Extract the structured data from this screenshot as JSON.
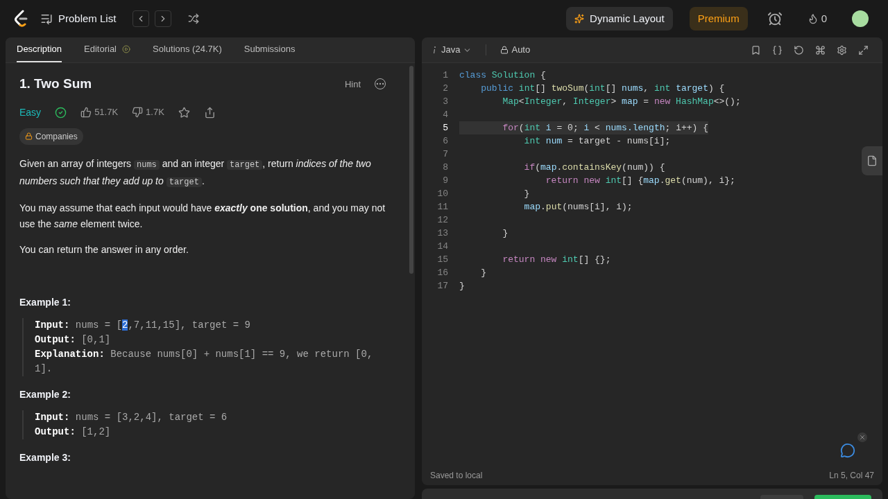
{
  "topbar": {
    "nav_label": "Problem List",
    "dynamic_layout": "Dynamic Layout",
    "premium": "Premium",
    "streak": "0"
  },
  "tabs": [
    {
      "label": "Description",
      "selected": true,
      "kind": "plain"
    },
    {
      "label": "Editorial",
      "selected": false,
      "kind": "video"
    },
    {
      "label": "Solutions (24.7K)",
      "selected": false,
      "kind": "plain"
    },
    {
      "label": "Submissions",
      "selected": false,
      "kind": "plain"
    }
  ],
  "problem": {
    "title": "1. Two Sum",
    "hint": "Hint",
    "difficulty": "Easy",
    "solved": true,
    "likes": "51.7K",
    "dislikes": "1.7K",
    "companies": "Companies",
    "paragraphs": [
      [
        {
          "kind": "text",
          "text": "Given an array of integers "
        },
        {
          "kind": "code",
          "text": "nums"
        },
        {
          "kind": "text",
          "text": " and an integer "
        },
        {
          "kind": "code",
          "text": "target"
        },
        {
          "kind": "text",
          "text": ", return *indices of the two numbers such that they add up to* "
        },
        {
          "kind": "code",
          "text": "target"
        },
        {
          "kind": "text",
          "text": "."
        }
      ],
      [
        {
          "kind": "text",
          "text": "You may assume that each input would have "
        },
        {
          "kind": "emphasis",
          "text": "exactly"
        },
        {
          "kind": "text",
          "text": " **one solution**, and you may not use the *same* element twice."
        }
      ],
      [
        {
          "kind": "text",
          "text": "You can return the answer in any order."
        }
      ]
    ],
    "examples": [
      {
        "title": "Example 1:",
        "lines": [
          {
            "label": "Input:",
            "value": [
              {
                "text": "nums = [",
                "selected": false
              },
              {
                "text": "2",
                "selected": true
              },
              {
                "text": ",7,11,15], target = 9",
                "selected": false
              }
            ]
          },
          {
            "label": "Output:",
            "value": [
              {
                "text": "[0,1]",
                "selected": false
              }
            ]
          },
          {
            "label": "Explanation:",
            "value": [
              {
                "text": "Because nums[0] + nums[1] == 9, we return [0, 1].",
                "selected": false
              }
            ]
          }
        ]
      },
      {
        "title": "Example 2:",
        "lines": [
          {
            "label": "Input:",
            "value": [
              {
                "text": "nums = [3,2,4], target = 6",
                "selected": false
              }
            ]
          },
          {
            "label": "Output:",
            "value": [
              {
                "text": "[1,2]",
                "selected": false
              }
            ]
          }
        ]
      },
      {
        "title": "Example 3:"
      }
    ]
  },
  "editor": {
    "language": "Java",
    "mode": "Auto",
    "lines": [
      {
        "number": "1",
        "current": false,
        "tokens": [
          {
            "kind": "kw",
            "text": "class "
          },
          {
            "kind": "type",
            "text": "Solution"
          },
          {
            "kind": "plain",
            "text": " {"
          }
        ]
      },
      {
        "number": "2",
        "current": false,
        "tokens": [
          {
            "kind": "kw",
            "text": "    public "
          },
          {
            "kind": "type",
            "text": "int"
          },
          {
            "kind": "plain",
            "text": "[] "
          },
          {
            "kind": "fn",
            "text": "twoSum"
          },
          {
            "kind": "plain",
            "text": "("
          },
          {
            "kind": "type",
            "text": "int"
          },
          {
            "kind": "plain",
            "text": "[] "
          },
          {
            "kind": "var",
            "text": "nums"
          },
          {
            "kind": "plain",
            "text": ", "
          },
          {
            "kind": "type",
            "text": "int "
          },
          {
            "kind": "var",
            "text": "target"
          },
          {
            "kind": "plain",
            "text": ") {"
          }
        ]
      },
      {
        "number": "3",
        "current": false,
        "tokens": [
          {
            "kind": "type",
            "text": "        Map"
          },
          {
            "kind": "plain",
            "text": "<"
          },
          {
            "kind": "type",
            "text": "Integer"
          },
          {
            "kind": "plain",
            "text": ", "
          },
          {
            "kind": "type",
            "text": "Integer"
          },
          {
            "kind": "plain",
            "text": "> "
          },
          {
            "kind": "var",
            "text": "map"
          },
          {
            "kind": "plain",
            "text": " = "
          },
          {
            "kind": "ctrl",
            "text": "new "
          },
          {
            "kind": "type",
            "text": "HashMap"
          },
          {
            "kind": "plain",
            "text": "<>();"
          }
        ]
      },
      {
        "number": "4",
        "current": false
      },
      {
        "number": "5",
        "current": true,
        "tokens": [
          {
            "kind": "ctrl",
            "text": "        for"
          },
          {
            "kind": "plain",
            "text": "("
          },
          {
            "kind": "type",
            "text": "int "
          },
          {
            "kind": "var",
            "text": "i"
          },
          {
            "kind": "plain",
            "text": " = 0; "
          },
          {
            "kind": "var",
            "text": "i"
          },
          {
            "kind": "plain",
            "text": " < "
          },
          {
            "kind": "var",
            "text": "nums.length"
          },
          {
            "kind": "plain",
            "text": "; i++) {"
          }
        ]
      },
      {
        "number": "6",
        "current": false,
        "tokens": [
          {
            "kind": "type",
            "text": "            int "
          },
          {
            "kind": "var",
            "text": "num"
          },
          {
            "kind": "plain",
            "text": " = target - nums[i];"
          }
        ]
      },
      {
        "number": "7",
        "current": false
      },
      {
        "number": "8",
        "current": false,
        "tokens": [
          {
            "kind": "ctrl",
            "text": "            if"
          },
          {
            "kind": "plain",
            "text": "("
          },
          {
            "kind": "var",
            "text": "map"
          },
          {
            "kind": "plain",
            "text": "."
          },
          {
            "kind": "fn",
            "text": "containsKey"
          },
          {
            "kind": "plain",
            "text": "(num)) {"
          }
        ]
      },
      {
        "number": "9",
        "current": false,
        "tokens": [
          {
            "kind": "ctrl",
            "text": "                return new "
          },
          {
            "kind": "type",
            "text": "int"
          },
          {
            "kind": "plain",
            "text": "[] {"
          },
          {
            "kind": "var",
            "text": "map"
          },
          {
            "kind": "plain",
            "text": "."
          },
          {
            "kind": "fn",
            "text": "get"
          },
          {
            "kind": "plain",
            "text": "(num), i};"
          }
        ]
      },
      {
        "number": "10",
        "current": false,
        "tokens": [
          {
            "kind": "plain",
            "text": "            }"
          }
        ]
      },
      {
        "number": "11",
        "current": false,
        "tokens": [
          {
            "kind": "var",
            "text": "            map"
          },
          {
            "kind": "plain",
            "text": "."
          },
          {
            "kind": "fn",
            "text": "put"
          },
          {
            "kind": "plain",
            "text": "(nums[i], i);"
          }
        ]
      },
      {
        "number": "12",
        "current": false
      },
      {
        "number": "13",
        "current": false,
        "tokens": [
          {
            "kind": "plain",
            "text": "        }"
          }
        ]
      },
      {
        "number": "14",
        "current": false
      },
      {
        "number": "15",
        "current": false,
        "tokens": [
          {
            "kind": "ctrl",
            "text": "        return new "
          },
          {
            "kind": "type",
            "text": "int"
          },
          {
            "kind": "plain",
            "text": "[] {};"
          }
        ]
      },
      {
        "number": "16",
        "current": false,
        "tokens": [
          {
            "kind": "plain",
            "text": "    }"
          }
        ]
      },
      {
        "number": "17",
        "current": false,
        "tokens": [
          {
            "kind": "plain",
            "text": "}"
          }
        ]
      }
    ],
    "status": "Saved to local",
    "position": "Ln 5, Col 47"
  }
}
